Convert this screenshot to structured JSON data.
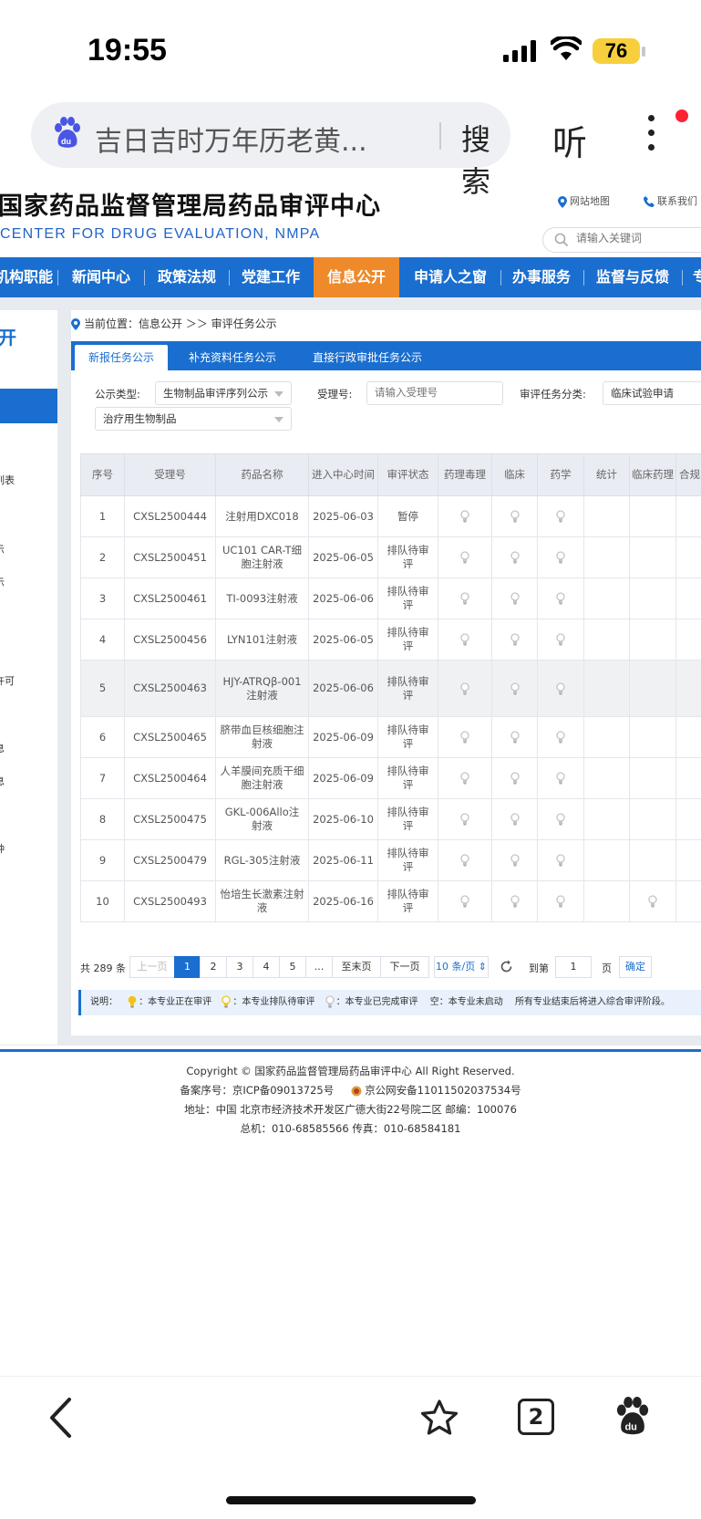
{
  "status": {
    "time": "19:55",
    "battery": "76"
  },
  "browser": {
    "query": "吉日吉时万年历老黄...",
    "search_label": "搜索",
    "listen_label": "听"
  },
  "site": {
    "title": "国家药品监督管理局药品审评中心",
    "subtitle": "CENTER FOR DRUG EVALUATION, NMPA",
    "links": [
      "网站地图",
      "联系我们"
    ],
    "search_placeholder": "请输入关键词"
  },
  "nav": [
    {
      "label": "机构职能"
    },
    {
      "label": "新闻中心"
    },
    {
      "label": "政策法规"
    },
    {
      "label": "党建工作"
    },
    {
      "label": "信息公开",
      "active": true
    },
    {
      "label": "申请人之窗"
    },
    {
      "label": "办事服务"
    },
    {
      "label": "监督与反馈"
    },
    {
      "label": "专"
    }
  ],
  "sidebar": {
    "title": "开",
    "items": [
      "列表",
      "示",
      "示",
      "许可",
      "息",
      "息",
      "种"
    ]
  },
  "breadcrumb": {
    "label": "当前位置：信息公开 ＞＞ 审评任务公示"
  },
  "tabs": [
    "新报任务公示",
    "补充资料任务公示",
    "直接行政审批任务公示"
  ],
  "filters": {
    "type_label": "公示类型:",
    "type_value": "生物制品审评序列公示",
    "accept_label": "受理号:",
    "accept_placeholder": "请输入受理号",
    "category_label": "审评任务分类:",
    "category_value": "临床试验申请",
    "subtype_value": "治疗用生物制品"
  },
  "table": {
    "headers": [
      "序号",
      "受理号",
      "药品名称",
      "进入中心时间",
      "审评状态",
      "药理毒理",
      "临床",
      "药学",
      "统计",
      "临床药理",
      "合规"
    ],
    "rows": [
      {
        "no": "1",
        "id": "CXSL2500444",
        "name": "注射用DXC018",
        "date": "2025-06-03",
        "status": "暂停",
        "bulbs": [
          1,
          1,
          1,
          0,
          0
        ]
      },
      {
        "no": "2",
        "id": "CXSL2500451",
        "name": "UC101 CAR-T细胞注射液",
        "date": "2025-06-05",
        "status": "排队待审评",
        "bulbs": [
          1,
          1,
          1,
          0,
          0
        ]
      },
      {
        "no": "3",
        "id": "CXSL2500461",
        "name": "TI-0093注射液",
        "date": "2025-06-06",
        "status": "排队待审评",
        "bulbs": [
          1,
          1,
          1,
          0,
          0
        ]
      },
      {
        "no": "4",
        "id": "CXSL2500456",
        "name": "LYN101注射液",
        "date": "2025-06-05",
        "status": "排队待审评",
        "bulbs": [
          1,
          1,
          1,
          0,
          0
        ]
      },
      {
        "no": "5",
        "id": "CXSL2500463",
        "name": "HJY-ATRQβ-001注射液",
        "date": "2025-06-06",
        "status": "排队待审评",
        "bulbs": [
          1,
          1,
          1,
          0,
          0
        ],
        "highlight": true
      },
      {
        "no": "6",
        "id": "CXSL2500465",
        "name": "脐带血巨核细胞注射液",
        "date": "2025-06-09",
        "status": "排队待审评",
        "bulbs": [
          1,
          1,
          1,
          0,
          0
        ]
      },
      {
        "no": "7",
        "id": "CXSL2500464",
        "name": "人羊膜间充质干细胞注射液",
        "date": "2025-06-09",
        "status": "排队待审评",
        "bulbs": [
          1,
          1,
          1,
          0,
          0
        ]
      },
      {
        "no": "8",
        "id": "CXSL2500475",
        "name": "GKL-006Allo注射液",
        "date": "2025-06-10",
        "status": "排队待审评",
        "bulbs": [
          1,
          1,
          1,
          0,
          0
        ]
      },
      {
        "no": "9",
        "id": "CXSL2500479",
        "name": "RGL-305注射液",
        "date": "2025-06-11",
        "status": "排队待审评",
        "bulbs": [
          1,
          1,
          1,
          0,
          0
        ]
      },
      {
        "no": "10",
        "id": "CXSL2500493",
        "name": "怡培生长激素注射液",
        "date": "2025-06-16",
        "status": "排队待审评",
        "bulbs": [
          1,
          1,
          1,
          0,
          1
        ]
      }
    ]
  },
  "pager": {
    "total": "共 289 条",
    "prev": "上一页",
    "pages": [
      "1",
      "2",
      "3",
      "4",
      "5",
      "..."
    ],
    "last": "至末页",
    "next": "下一页",
    "per_page": "10 条/页",
    "goto_label": "到第",
    "goto_value": "1",
    "page_suffix": "页",
    "confirm": "确定"
  },
  "legend": {
    "label": "说明：",
    "items": [
      "：本专业正在审评",
      "：本专业排队待审评",
      "：本专业已完成审评"
    ],
    "empty_note": "空：本专业未启动",
    "tail": "所有专业结束后将进入综合审评阶段。"
  },
  "footer": {
    "copyright": "Copyright © 国家药品监督管理局药品审评中心   All Right Reserved.",
    "icp": "备案序号：京ICP备09013725号",
    "police": "京公网安备11011502037534号",
    "address": "地址：中国 北京市经济技术开发区广德大街22号院二区      邮编：100076",
    "phone": "总机：010-68585566      传真：010-68584181"
  },
  "bottom": {
    "tab_count": "2"
  },
  "colors": {
    "brand_blue": "#1a6ecf",
    "active_orange": "#ee8a2a",
    "bulb_gray": "#c4c4c4"
  }
}
